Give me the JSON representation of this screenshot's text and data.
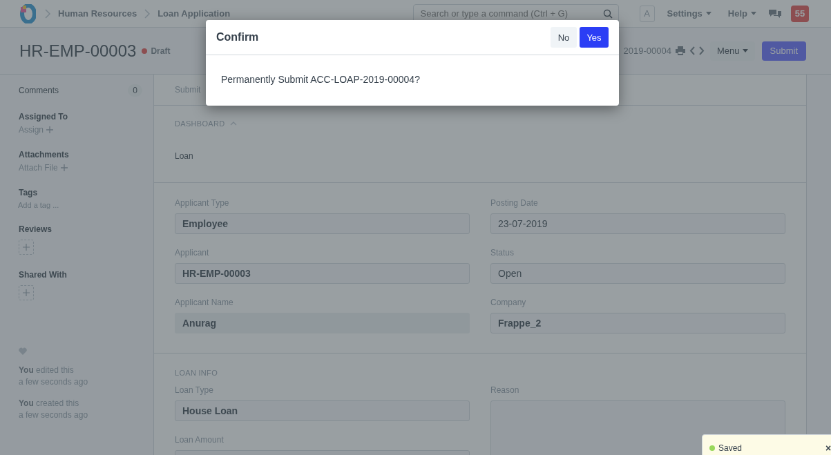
{
  "navbar": {
    "breadcrumbs": [
      "Human Resources",
      "Loan Application"
    ],
    "search": {
      "placeholder": "Search or type a command (Ctrl + G)"
    },
    "avatar": "A",
    "menus": [
      "Settings",
      "Help"
    ],
    "notifications": "55"
  },
  "header": {
    "title": "HR-EMP-00003",
    "status": "Draft",
    "doc_name": "2019-00004",
    "menu_button": "Menu",
    "submit_button": "Submit"
  },
  "sidebar": {
    "comments": {
      "label": "Comments",
      "count": "0"
    },
    "sections": [
      {
        "title": "Assigned To",
        "kind": "link",
        "action": "Assign"
      },
      {
        "title": "Attachments",
        "kind": "link",
        "action": "Attach File"
      },
      {
        "title": "Tags",
        "kind": "tag",
        "action": "Add a tag ..."
      },
      {
        "title": "Reviews",
        "kind": "add"
      },
      {
        "title": "Shared With",
        "kind": "add"
      }
    ],
    "activity": [
      {
        "text": "**You** edited this",
        "time": "a few seconds ago"
      },
      {
        "text": "**You** created this",
        "time": "a few seconds ago"
      }
    ]
  },
  "form": {
    "notice": "Submit",
    "dashboard": {
      "title": "DASHBOARD",
      "expanded": true,
      "items": [
        "Loan"
      ]
    },
    "sections": [
      {
        "fields_left": [
          {
            "label": "Applicant Type",
            "value": "Employee",
            "kind": "link"
          },
          {
            "label": "Applicant",
            "value": "HR-EMP-00003",
            "kind": "link"
          },
          {
            "label": "Applicant Name",
            "value": "Anurag",
            "kind": "readonly"
          }
        ],
        "fields_right": [
          {
            "label": "Posting Date",
            "value": "23-07-2019",
            "kind": "data"
          },
          {
            "label": "Status",
            "value": "Open",
            "kind": "data"
          },
          {
            "label": "Company",
            "value": "Frappe_2",
            "kind": "link"
          }
        ]
      },
      {
        "title": "LOAN INFO",
        "fields_left": [
          {
            "label": "Loan Type",
            "value": "House Loan",
            "kind": "link"
          },
          {
            "label": "Loan Amount",
            "kind": "data"
          }
        ],
        "fields_right": [
          {
            "label": "Reason",
            "kind": "textarea"
          }
        ]
      }
    ]
  },
  "dialog": {
    "title": "Confirm",
    "message": "Permanently Submit ACC-LOAP-2019-00004?",
    "buttons": [
      {
        "label": "No",
        "kind": "secondary"
      },
      {
        "label": "Yes",
        "kind": "primary"
      }
    ]
  },
  "toast": {
    "message": "Saved",
    "close": "×"
  }
}
